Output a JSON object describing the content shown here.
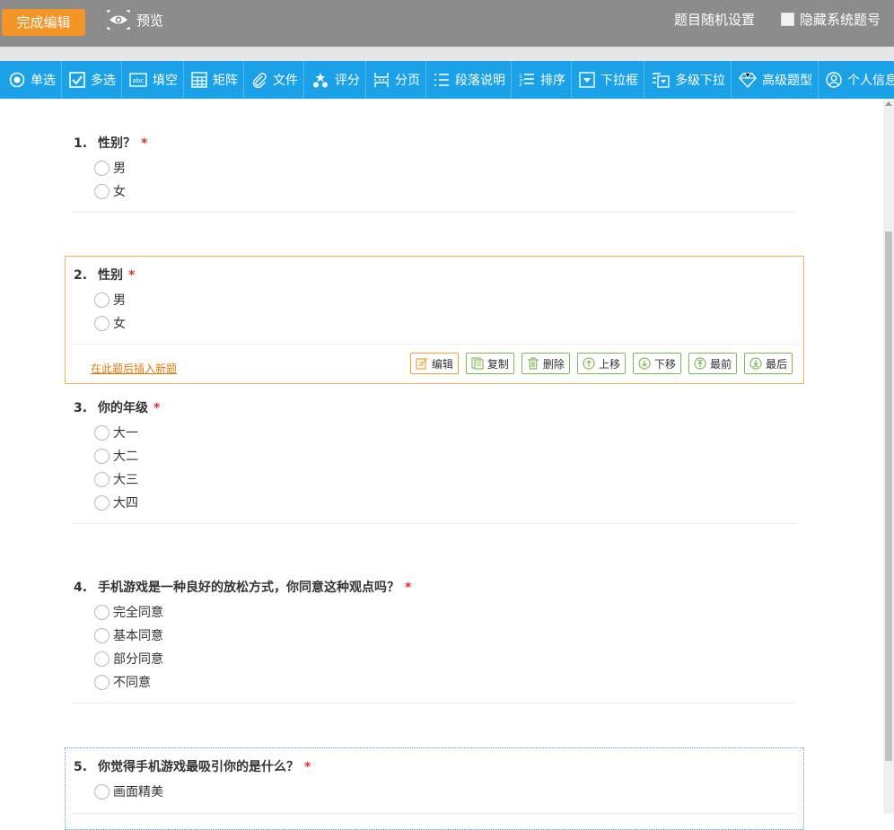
{
  "topbar": {
    "done_label": "完成编辑",
    "preview_label": "预览",
    "random_label": "题目随机设置",
    "hide_label": "隐藏系统题号"
  },
  "toolbar": {
    "items": [
      {
        "label": "单选",
        "icon": "radio-icon"
      },
      {
        "label": "多选",
        "icon": "checkbox-icon"
      },
      {
        "label": "填空",
        "icon": "textfield-icon"
      },
      {
        "label": "矩阵",
        "icon": "matrix-icon"
      },
      {
        "label": "文件",
        "icon": "paperclip-icon"
      },
      {
        "label": "评分",
        "icon": "stars-icon"
      },
      {
        "label": "分页",
        "icon": "pagebreak-icon"
      },
      {
        "label": "段落说明",
        "icon": "list-icon"
      },
      {
        "label": "排序",
        "icon": "sort-icon"
      },
      {
        "label": "下拉框",
        "icon": "dropdown-icon"
      },
      {
        "label": "多级下拉",
        "icon": "multilevel-dropdown-icon"
      },
      {
        "label": "高级题型",
        "icon": "diamond-icon"
      },
      {
        "label": "个人信息",
        "icon": "user-icon"
      }
    ]
  },
  "questions": [
    {
      "num": "1.",
      "title": "性别？",
      "required": "*",
      "options": [
        "男",
        "女"
      ]
    },
    {
      "num": "2.",
      "title": "性别",
      "required": "*",
      "options": [
        "男",
        "女"
      ]
    },
    {
      "num": "3.",
      "title": "你的年级",
      "required": "*",
      "options": [
        "大一",
        "大二",
        "大三",
        "大四"
      ]
    },
    {
      "num": "4.",
      "title": "手机游戏是一种良好的放松方式，你同意这种观点吗？",
      "required": "*",
      "options": [
        "完全同意",
        "基本同意",
        "部分同意",
        "不同意"
      ]
    },
    {
      "num": "5.",
      "title": "你觉得手机游戏最吸引你的是什么？",
      "required": "*",
      "options": [
        "画面精美"
      ]
    }
  ],
  "active_question": {
    "insert_label": "在此题后插入新题",
    "buttons": [
      {
        "label": "编辑",
        "icon": "edit-icon",
        "color": "#f0a23f"
      },
      {
        "label": "复制",
        "icon": "copy-icon",
        "color": "#7fba5a"
      },
      {
        "label": "删除",
        "icon": "trash-icon",
        "color": "#7fba5a"
      },
      {
        "label": "上移",
        "icon": "arrow-up-icon",
        "color": "#7fba5a"
      },
      {
        "label": "下移",
        "icon": "arrow-down-icon",
        "color": "#7fba5a"
      },
      {
        "label": "最前",
        "icon": "to-top-icon",
        "color": "#7fba5a"
      },
      {
        "label": "最后",
        "icon": "to-bottom-icon",
        "color": "#7fba5a"
      }
    ]
  },
  "colors": {
    "topbar": "#8c8c8c",
    "toolbar": "#1aa1e7",
    "done_button": "#f39426",
    "required": "#e62d2d",
    "active_border": "#f3b25e",
    "link": "#e07b0a"
  }
}
